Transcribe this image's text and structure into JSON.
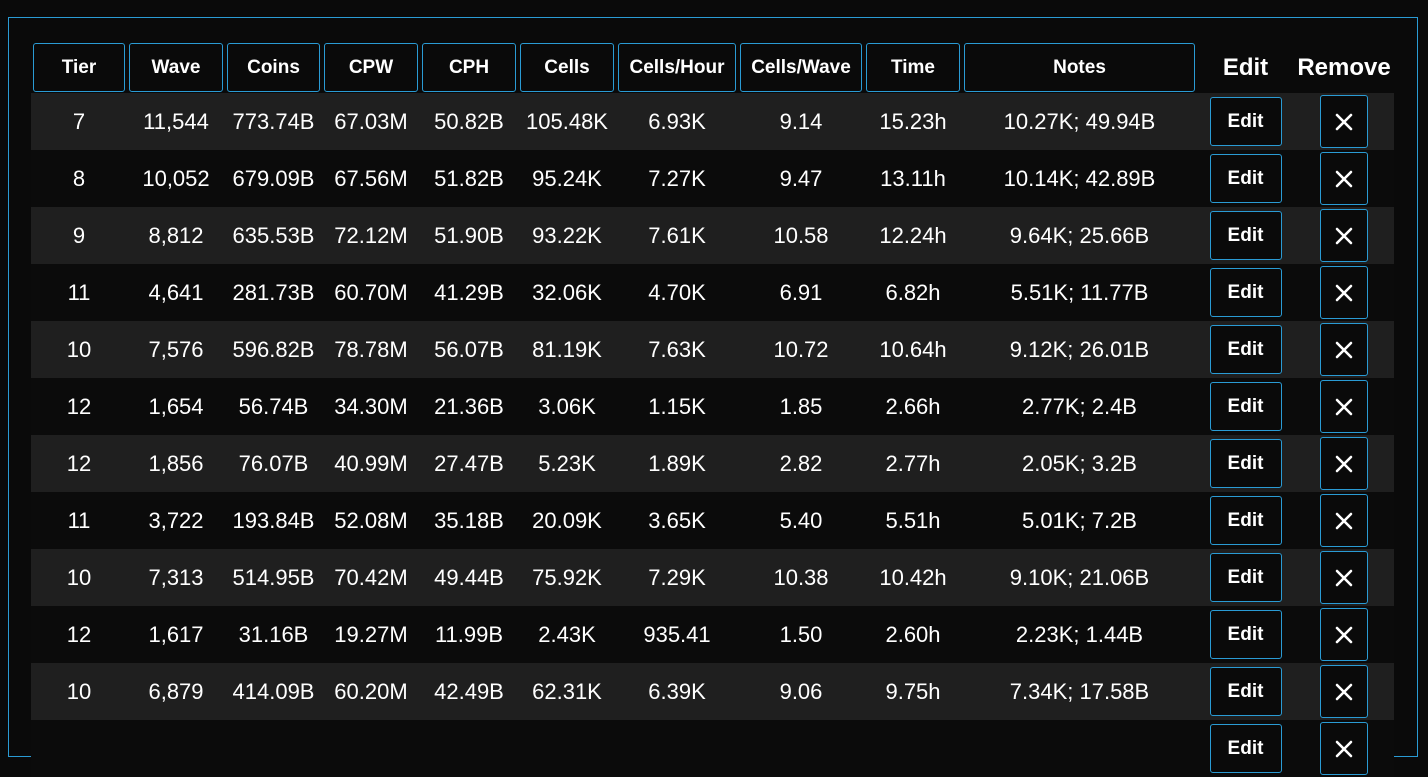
{
  "columns": [
    "Tier",
    "Wave",
    "Coins",
    "CPW",
    "CPH",
    "Cells",
    "Cells/Hour",
    "Cells/Wave",
    "Time",
    "Notes",
    "Edit",
    "Remove"
  ],
  "edit_label": "Edit",
  "remove_icon": "close-icon",
  "accent_color": "#2a9bd4",
  "rows": [
    [
      "7",
      "11,544",
      "773.74B",
      "67.03M",
      "50.82B",
      "105.48K",
      "6.93K",
      "9.14",
      "15.23h",
      "10.27K; 49.94B"
    ],
    [
      "8",
      "10,052",
      "679.09B",
      "67.56M",
      "51.82B",
      "95.24K",
      "7.27K",
      "9.47",
      "13.11h",
      "10.14K; 42.89B"
    ],
    [
      "9",
      "8,812",
      "635.53B",
      "72.12M",
      "51.90B",
      "93.22K",
      "7.61K",
      "10.58",
      "12.24h",
      "9.64K; 25.66B"
    ],
    [
      "11",
      "4,641",
      "281.73B",
      "60.70M",
      "41.29B",
      "32.06K",
      "4.70K",
      "6.91",
      "6.82h",
      "5.51K; 11.77B"
    ],
    [
      "10",
      "7,576",
      "596.82B",
      "78.78M",
      "56.07B",
      "81.19K",
      "7.63K",
      "10.72",
      "10.64h",
      "9.12K; 26.01B"
    ],
    [
      "12",
      "1,654",
      "56.74B",
      "34.30M",
      "21.36B",
      "3.06K",
      "1.15K",
      "1.85",
      "2.66h",
      "2.77K; 2.4B"
    ],
    [
      "12",
      "1,856",
      "76.07B",
      "40.99M",
      "27.47B",
      "5.23K",
      "1.89K",
      "2.82",
      "2.77h",
      "2.05K; 3.2B"
    ],
    [
      "11",
      "3,722",
      "193.84B",
      "52.08M",
      "35.18B",
      "20.09K",
      "3.65K",
      "5.40",
      "5.51h",
      "5.01K; 7.2B"
    ],
    [
      "10",
      "7,313",
      "514.95B",
      "70.42M",
      "49.44B",
      "75.92K",
      "7.29K",
      "10.38",
      "10.42h",
      "9.10K; 21.06B"
    ],
    [
      "12",
      "1,617",
      "31.16B",
      "19.27M",
      "11.99B",
      "2.43K",
      "935.41",
      "1.50",
      "2.60h",
      "2.23K; 1.44B"
    ],
    [
      "10",
      "6,879",
      "414.09B",
      "60.20M",
      "42.49B",
      "62.31K",
      "6.39K",
      "9.06",
      "9.75h",
      "7.34K; 17.58B"
    ],
    [
      "",
      "",
      "",
      "",
      "",
      "",
      "",
      "",
      "",
      ""
    ]
  ]
}
